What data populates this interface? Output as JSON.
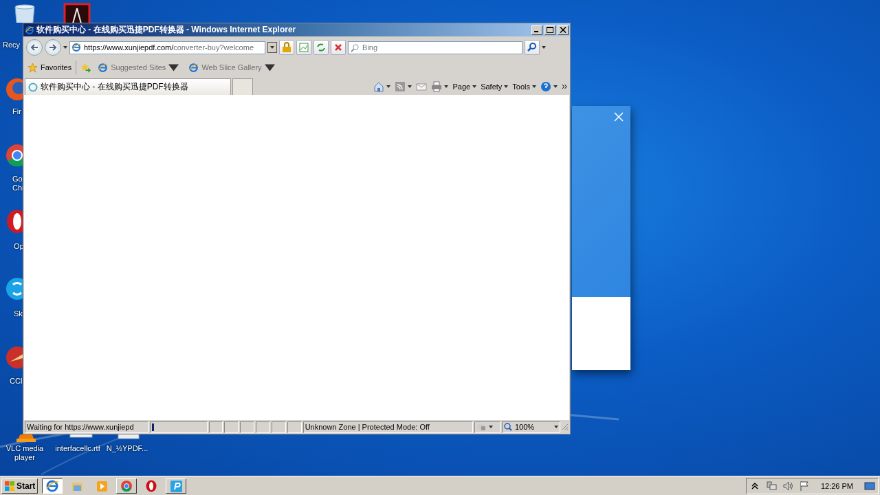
{
  "desktop_icons": [
    {
      "kind": "recycle",
      "label": "Recy"
    },
    {
      "kind": "acrobat"
    },
    {
      "kind": "firefox",
      "label": "Fir"
    },
    {
      "kind": "chrome",
      "label": "Go\nChr"
    },
    {
      "kind": "opera",
      "label": "Op"
    },
    {
      "kind": "skype",
      "label": "Sk"
    },
    {
      "kind": "ccleaner",
      "label": "CCl"
    },
    {
      "kind": "vlc",
      "label": "VLC media player"
    },
    {
      "kind": "rtf",
      "label": "interfacellc.rtf"
    },
    {
      "kind": "app",
      "label": "N_½YPDF..."
    }
  ],
  "window": {
    "title": "软件购买中心 - 在线购买迅捷PDF转换器 - Windows Internet Explorer",
    "address": {
      "host": "https://www.xunjiepdf.com/",
      "path": "converter-buy?welcome"
    },
    "search": {
      "placeholder": "Bing"
    },
    "favorites": {
      "label": "Favorites",
      "links": [
        "Suggested Sites",
        "Web Slice Gallery"
      ]
    },
    "tabs": [
      {
        "label": "软件购买中心 - 在线购买迅捷PDF转换器",
        "selected": true
      }
    ],
    "commands": [
      "Page",
      "Safety",
      "Tools"
    ],
    "status": {
      "text": "Waiting for https://www.xunjiepd",
      "level": 0.04,
      "zone": "Unknown Zone | Protected Mode: Off",
      "zoom": "100%"
    }
  },
  "taskbar": {
    "start": "Start",
    "items": [
      {
        "kind": "ie",
        "selected": true,
        "running": true
      },
      {
        "kind": "explorer",
        "selected": false,
        "running": false
      },
      {
        "kind": "media",
        "selected": false,
        "running": false
      },
      {
        "kind": "chrome",
        "selected": false,
        "running": true
      },
      {
        "kind": "opera",
        "selected": false,
        "running": false
      },
      {
        "kind": "app",
        "selected": false,
        "running": true
      }
    ],
    "clock": "12:26 PM"
  }
}
